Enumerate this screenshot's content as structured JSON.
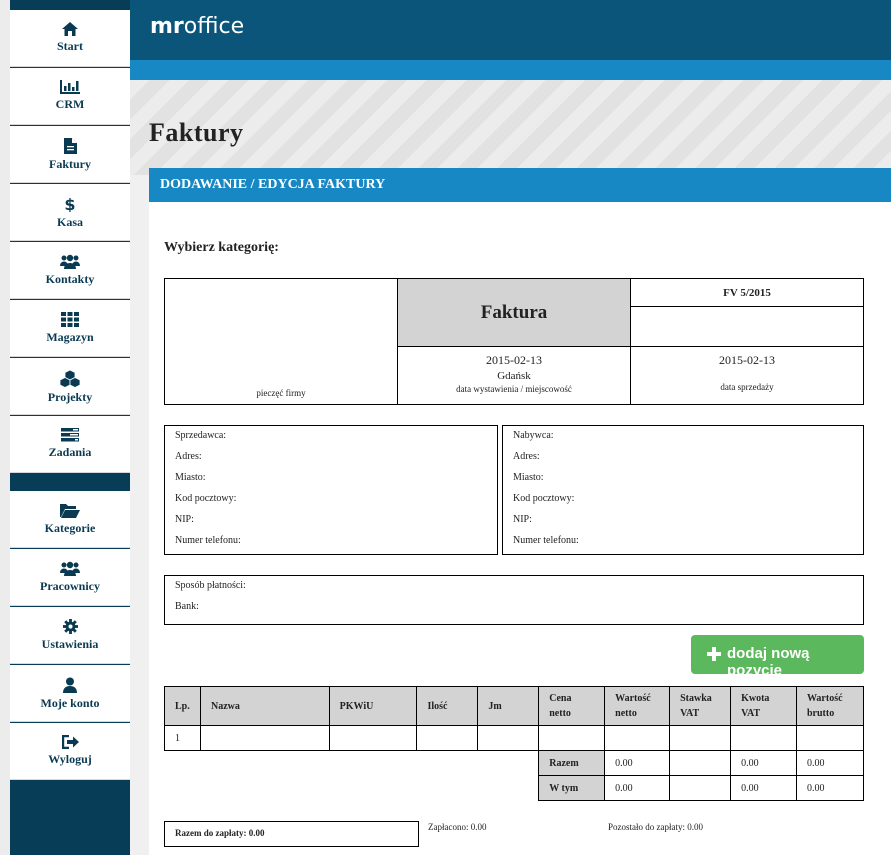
{
  "app": {
    "logo_bold": "mr",
    "logo_rest": "office"
  },
  "sidebar": {
    "items": [
      {
        "label": "Start",
        "icon": "home-icon"
      },
      {
        "label": "CRM",
        "icon": "bar-chart-icon"
      },
      {
        "label": "Faktury",
        "icon": "document-icon"
      },
      {
        "label": "Kasa",
        "icon": "dollar-icon"
      },
      {
        "label": "Kontakty",
        "icon": "users-icon"
      },
      {
        "label": "Magazyn",
        "icon": "grid-icon"
      },
      {
        "label": "Projekty",
        "icon": "cubes-icon"
      },
      {
        "label": "Zadania",
        "icon": "tasks-icon"
      },
      {
        "label": "Kategorie",
        "icon": "folder-open-icon"
      },
      {
        "label": "Pracownicy",
        "icon": "users-icon"
      },
      {
        "label": "Ustawienia",
        "icon": "gear-icon"
      },
      {
        "label": "Moje konto",
        "icon": "user-icon"
      },
      {
        "label": "Wyloguj",
        "icon": "sign-out-icon"
      }
    ]
  },
  "page": {
    "title": "Faktury",
    "panel_title": "DODAWANIE / EDYCJA FAKTURY",
    "category_label": "Wybierz kategorię:"
  },
  "invoice": {
    "doc_title": "Faktura",
    "number": "FV 5/2015",
    "stamp_label": "pieczęć firmy",
    "issue_date": "2015-02-13",
    "place": "Gdańsk",
    "issue_label": "data wystawienia / miejscowość",
    "sale_date": "2015-02-13",
    "sale_label": "data sprzedaży"
  },
  "seller": {
    "fields": [
      "Sprzedawca:",
      "Adres:",
      "Miasto:",
      "Kod pocztowy:",
      "NIP:",
      "Numer telefonu:"
    ]
  },
  "buyer": {
    "fields": [
      "Nabywca:",
      "Adres:",
      "Miasto:",
      "Kod pocztowy:",
      "NIP:",
      "Numer telefonu:"
    ]
  },
  "payment": {
    "method_label": "Sposób płatności:",
    "bank_label": "Bank:"
  },
  "add_button": {
    "label": "dodaj nową pozycję"
  },
  "items": {
    "headers": [
      "Lp.",
      "Nazwa",
      "PKWiU",
      "Ilość",
      "Jm",
      "Cena netto",
      "Wartość netto",
      "Stawka VAT",
      "Kwota VAT",
      "Wartość brutto"
    ],
    "rows": [
      [
        "1",
        "",
        "",
        "",
        "",
        "",
        "",
        "",
        "",
        ""
      ]
    ],
    "totals": [
      {
        "label": "Razem",
        "netto": "0.00",
        "stawka": "",
        "vat": "0.00",
        "brutto": "0.00"
      },
      {
        "label": "W tym",
        "netto": "0.00",
        "stawka": "",
        "vat": "0.00",
        "brutto": "0.00"
      }
    ]
  },
  "summary": {
    "to_pay": "Razem do zapłaty: 0.00",
    "paid": "Zapłacono: 0.00",
    "remaining": "Pozostało do zapłaty: 0.00"
  },
  "colors": {
    "sidebar": "#083d57",
    "topbar": "#0a5579",
    "accent": "#1788c4",
    "button": "#5cb85c"
  }
}
